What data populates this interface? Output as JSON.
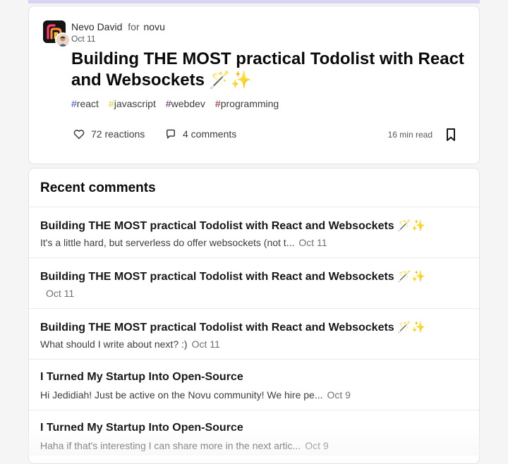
{
  "post": {
    "author": "Nevo David",
    "for_label": "for",
    "organization": "novu",
    "date": "Oct 11",
    "title": "Building THE MOST practical Todolist with React and Websockets 🪄✨",
    "tags": [
      {
        "hash": "#",
        "name": "react",
        "hash_color": "#3b49df"
      },
      {
        "hash": "#",
        "name": "javascript",
        "hash_color": "#e3d045"
      },
      {
        "hash": "#",
        "name": "webdev",
        "hash_color": "#562765"
      },
      {
        "hash": "#",
        "name": "programming",
        "hash_color": "#89252e"
      }
    ],
    "reactions": "72 reactions",
    "comments": "4 comments",
    "read_time": "16 min read"
  },
  "recent_comments": {
    "heading": "Recent comments",
    "items": [
      {
        "title": "Building THE MOST practical Todolist with React and Websockets 🪄✨",
        "excerpt": "It's a little hard, but serverless do offer websockets (not t...",
        "date": "Oct 11"
      },
      {
        "title": "Building THE MOST practical Todolist with React and Websockets 🪄✨",
        "excerpt": "",
        "date": "Oct 11"
      },
      {
        "title": "Building THE MOST practical Todolist with React and Websockets 🪄✨",
        "excerpt": "What should I write about next? :)",
        "date": "Oct 11"
      },
      {
        "title": "I Turned My Startup Into Open-Source",
        "excerpt": "Hi Jedidiah! Just be active on the Novu community! We hire pe...",
        "date": "Oct 9"
      },
      {
        "title": "I Turned My Startup Into Open-Source",
        "excerpt": "Haha if that's interesting I can share more in the next artic...",
        "date": "Oct 9"
      }
    ]
  },
  "colors": {
    "accent": "#3b49df",
    "text": "#171717",
    "muted": "#717171"
  },
  "icons": {
    "org_logo": "novu-logo-icon",
    "avatar": "author-avatar",
    "reactions": "heart-icon",
    "comments": "comment-bubble-icon",
    "bookmark": "bookmark-icon"
  }
}
